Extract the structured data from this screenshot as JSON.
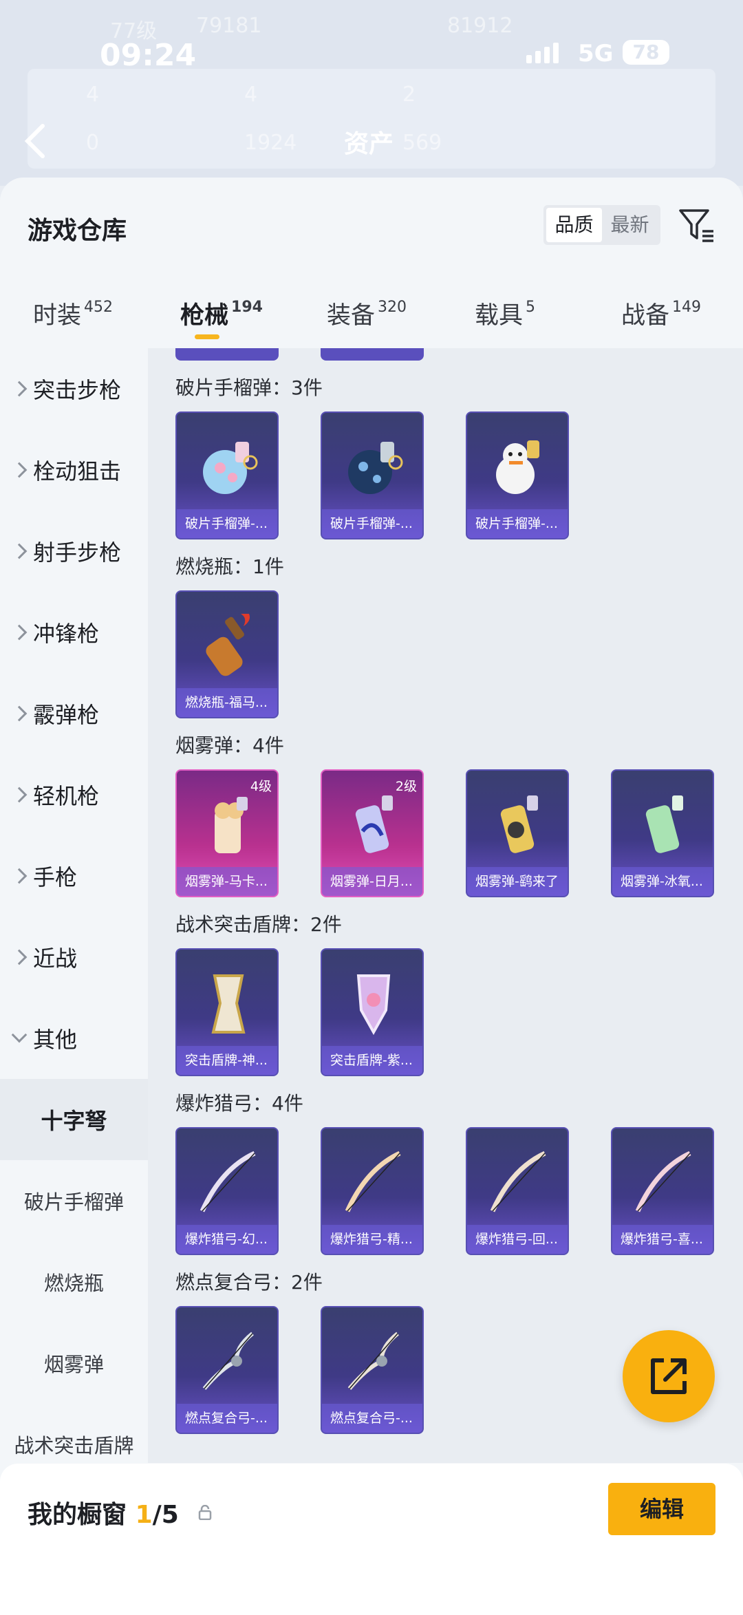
{
  "status": {
    "time": "09:24",
    "network": "5G",
    "battery": "78"
  },
  "background": {
    "level": "77级",
    "views": "79181",
    "score": "81912",
    "asset_label": "资产",
    "stats": [
      "4",
      "4",
      "2",
      "0",
      "1924",
      "569"
    ]
  },
  "header": {
    "title": "游戏仓库",
    "sort_options": [
      "品质",
      "最新"
    ]
  },
  "tabs": [
    {
      "label": "时装",
      "count": "452"
    },
    {
      "label": "枪械",
      "count": "194"
    },
    {
      "label": "装备",
      "count": "320"
    },
    {
      "label": "载具",
      "count": "5"
    },
    {
      "label": "战备",
      "count": "149"
    }
  ],
  "sidebar": {
    "categories": [
      "突击步枪",
      "栓动狙击",
      "射手步枪",
      "冲锋枪",
      "霰弹枪",
      "轻机枪",
      "手枪",
      "近战",
      "其他"
    ],
    "subcategories": [
      "十字弩",
      "破片手榴弹",
      "燃烧瓶",
      "烟雾弹",
      "战术突击盾牌"
    ]
  },
  "sections": [
    {
      "title": "破片手榴弹：3件",
      "items": [
        {
          "name": "破片手榴弹-..."
        },
        {
          "name": "破片手榴弹-..."
        },
        {
          "name": "破片手榴弹-..."
        }
      ]
    },
    {
      "title": "燃烧瓶：1件",
      "items": [
        {
          "name": "燃烧瓶-福马..."
        }
      ]
    },
    {
      "title": "烟雾弹：4件",
      "items": [
        {
          "name": "烟雾弹-马卡...",
          "level": "4级"
        },
        {
          "name": "烟雾弹-日月...",
          "level": "2级"
        },
        {
          "name": "烟雾弹-鹞来了"
        },
        {
          "name": "烟雾弹-冰氧..."
        }
      ]
    },
    {
      "title": "战术突击盾牌：2件",
      "items": [
        {
          "name": "突击盾牌-神..."
        },
        {
          "name": "突击盾牌-紫..."
        }
      ]
    },
    {
      "title": "爆炸猎弓：4件",
      "items": [
        {
          "name": "爆炸猎弓-幻..."
        },
        {
          "name": "爆炸猎弓-精..."
        },
        {
          "name": "爆炸猎弓-回..."
        },
        {
          "name": "爆炸猎弓-喜..."
        }
      ]
    },
    {
      "title": "燃点复合弓：2件",
      "items": [
        {
          "name": "燃点复合弓-..."
        },
        {
          "name": "燃点复合弓-..."
        }
      ]
    }
  ],
  "showcase": {
    "label": "我的橱窗",
    "current": "1",
    "total": "/5",
    "edit_label": "编辑"
  }
}
